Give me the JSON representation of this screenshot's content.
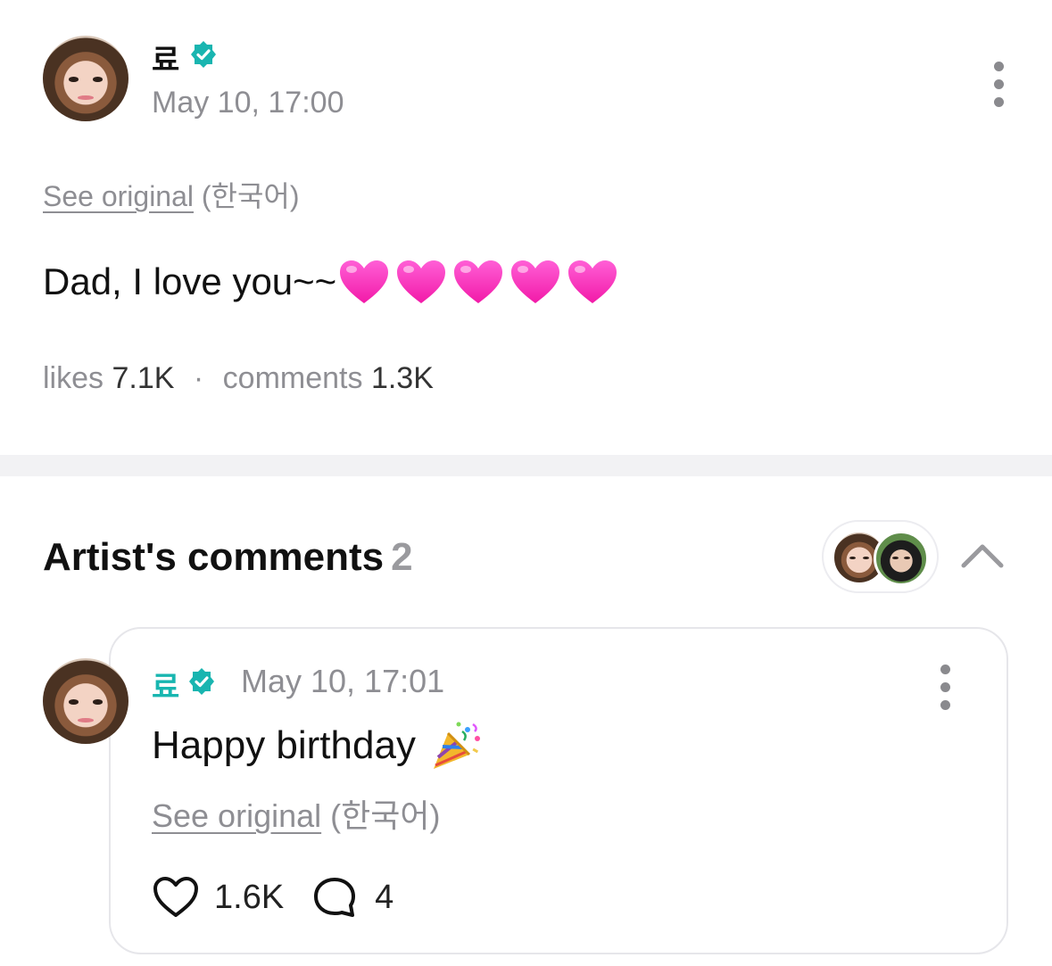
{
  "post": {
    "author_name": "료",
    "date": "May 10, 17:00",
    "see_original_link": "See original",
    "see_original_lang": "(한국어)",
    "text": "Dad, I love you~~",
    "heart_emoji_count": 5,
    "likes_label": "likes",
    "likes_count": "7.1K",
    "separator": "·",
    "comments_label": "comments",
    "comments_count": "1.3K"
  },
  "artist_comments": {
    "title": "Artist's comments",
    "count": "2",
    "comment": {
      "author_name": "료",
      "date": "May 10, 17:01",
      "text": "Happy birthday",
      "emoji": "party-popper-icon",
      "see_original_link": "See original",
      "see_original_lang": "(한국어)",
      "like_count": "1.6K",
      "reply_count": "4"
    }
  },
  "colors": {
    "verified": "#19b5b0",
    "comment_author": "#18b6b0",
    "heart": "#ff2ec4",
    "muted_text": "#8e8e93"
  }
}
